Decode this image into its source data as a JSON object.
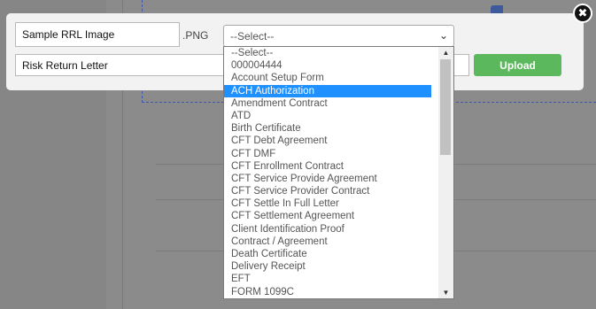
{
  "modal": {
    "name_field_value": "Sample RRL Image",
    "extension": ".PNG",
    "description_field_value": "Risk Return Letter",
    "select_value": "--Select--",
    "upload_label": "Upload",
    "close_glyph": "✖"
  },
  "dropdown": {
    "options": [
      "--Select--",
      "000004444",
      "Account Setup Form",
      "ACH Authorization",
      "Amendment Contract",
      "ATD",
      "Birth Certificate",
      "CFT Debt Agreement",
      "CFT DMF",
      "CFT Enrollment Contract",
      "CFT Service Provide Agreement",
      "CFT Service Provider Contract",
      "CFT Settle In Full Letter",
      "CFT Settlement Agreement",
      "Client Identification Proof",
      "Contract / Agreement",
      "Death Certificate",
      "Delivery Receipt",
      "EFT",
      "FORM 1099C"
    ],
    "highlighted": "ACH Authorization",
    "highlight_color": "#1e90ff"
  },
  "colors": {
    "upload_button": "#5cb85c",
    "overlay": "#868686"
  }
}
